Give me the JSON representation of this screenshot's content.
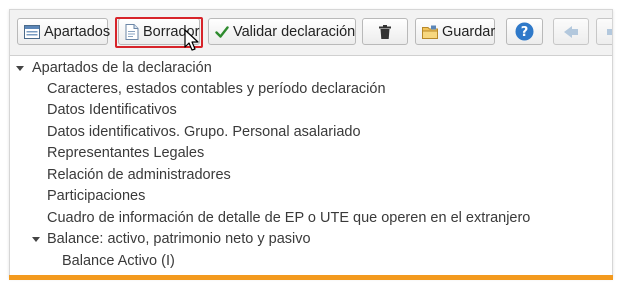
{
  "toolbar": {
    "apartados_label": "Apartados",
    "borrador_label": "Borrador",
    "validar_label": "Validar declaración",
    "guardar_label": "Guardar"
  },
  "tree": {
    "root_label": "Apartados de la declaración",
    "items": [
      "Caracteres, estados contables y período declaración",
      "Datos Identificativos",
      "Datos identificativos. Grupo. Personal asalariado",
      "Representantes Legales",
      "Relación de administradores",
      "Participaciones",
      "Cuadro de información de detalle de EP o UTE que operen en el extranjero"
    ],
    "balance_label": "Balance: activo, patrimonio neto y pasivo",
    "balance_children": [
      "Balance Activo (I)"
    ]
  },
  "colors": {
    "highlight": "#d7242a",
    "accent_bar": "#f39a1e",
    "help_icon": "#2f79c9",
    "check": "#2e8b2e"
  }
}
